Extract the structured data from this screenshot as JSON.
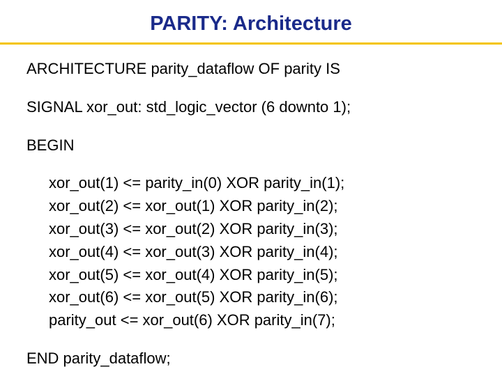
{
  "title": "PARITY: Architecture",
  "lines": {
    "arch_decl": "ARCHITECTURE parity_dataflow OF parity IS",
    "signal_decl": "SIGNAL xor_out: std_logic_vector (6 downto 1);",
    "begin": "BEGIN",
    "assign1": "xor_out(1) <= parity_in(0) XOR parity_in(1);",
    "assign2": "xor_out(2) <= xor_out(1) XOR parity_in(2);",
    "assign3": "xor_out(3) <= xor_out(2) XOR parity_in(3);",
    "assign4": "xor_out(4) <= xor_out(3) XOR parity_in(4);",
    "assign5": "xor_out(5) <= xor_out(4) XOR parity_in(5);",
    "assign6": "xor_out(6) <= xor_out(5) XOR parity_in(6);",
    "assign_out": "parity_out <= xor_out(6) XOR parity_in(7);",
    "end": "END parity_dataflow;"
  }
}
